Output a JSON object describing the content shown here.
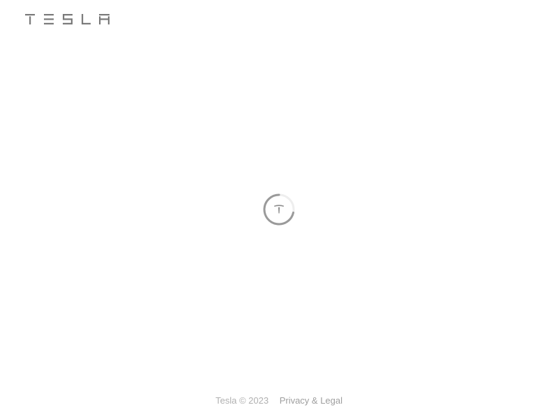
{
  "header": {
    "logo_label": "TESLA",
    "logo_icon": "tesla-wordmark",
    "logo_color": "#7a7a7a"
  },
  "main": {
    "loading_indicator_icon": "tesla-t-spinner",
    "spinner_color": "#9a9a9a"
  },
  "footer": {
    "copyright": "Tesla © 2023",
    "privacy_legal_link": "Privacy & Legal"
  }
}
